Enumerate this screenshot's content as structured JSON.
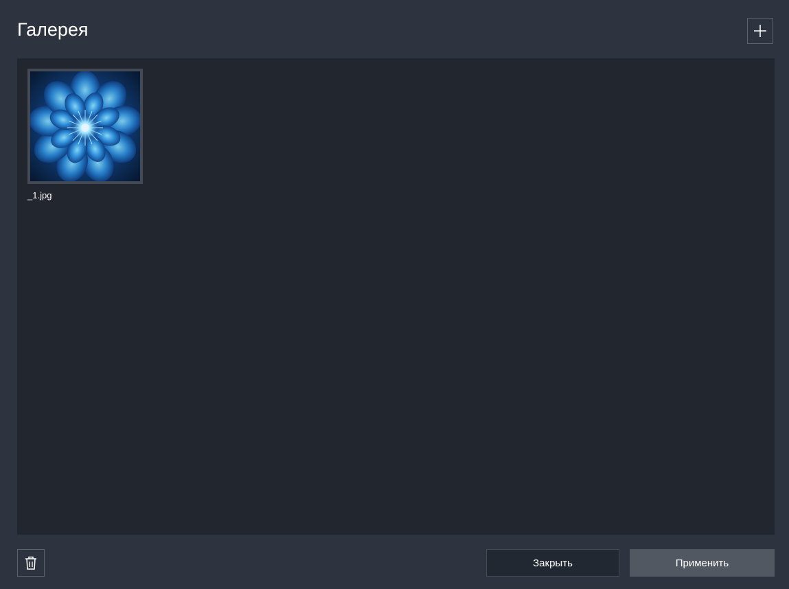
{
  "header": {
    "title": "Галерея",
    "add_icon": "plus-icon"
  },
  "gallery": {
    "items": [
      {
        "file_name": "_1.jpg",
        "selected": true
      }
    ]
  },
  "footer": {
    "delete_icon": "trash-icon",
    "close_label": "Закрыть",
    "apply_label": "Применить"
  },
  "colors": {
    "background": "#2e343f",
    "gallery_background": "#22272f",
    "apply_button": "#515861",
    "close_button": "#222831",
    "text": "#ffffff"
  }
}
